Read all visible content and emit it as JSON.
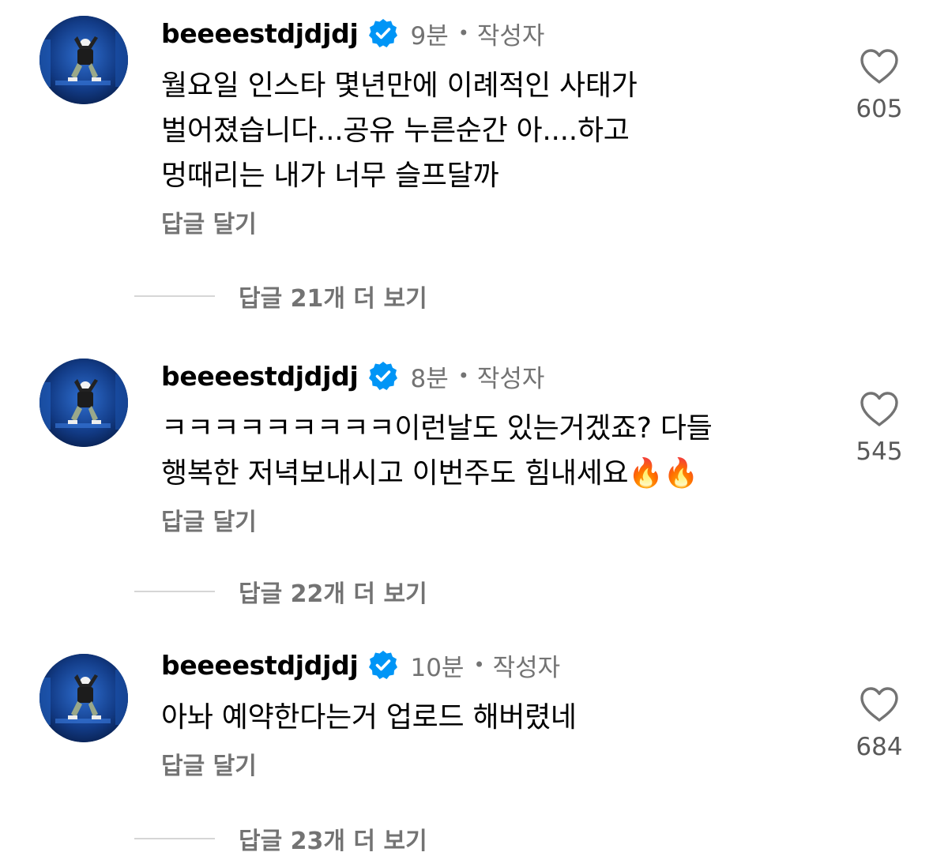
{
  "colors": {
    "secondary_text": "#737373",
    "verified_badge": "#0095f6",
    "divider": "#d6d6d6"
  },
  "icons": {
    "verified": "verified-badge-icon",
    "like": "heart-outline-icon"
  },
  "comments": [
    {
      "username": "beeeestdjdjdj",
      "time": "9분",
      "separator": "•",
      "author_label": "작성자",
      "lines": [
        "월요일 인스타 몇년만에 이례적인 사태가",
        "벌어졌습니다...공유 누른순간 아....하고",
        "멍때리는 내가 너무 슬프달까"
      ],
      "reply_label": "답글 달기",
      "like_count": "605",
      "view_replies_label": "답글 21개 더 보기"
    },
    {
      "username": "beeeestdjdjdj",
      "time": "8분",
      "separator": "•",
      "author_label": "작성자",
      "lines": [
        "ㅋㅋㅋㅋㅋㅋㅋㅋㅋ이런날도 있는거겠죠? 다들",
        "행복한 저녁보내시고 이번주도 힘내세요🔥🔥"
      ],
      "reply_label": "답글 달기",
      "like_count": "545",
      "view_replies_label": "답글 22개 더 보기"
    },
    {
      "username": "beeeestdjdjdj",
      "time": "10분",
      "separator": "•",
      "author_label": "작성자",
      "lines": [
        "아놔 예약한다는거 업로드 해버렸네"
      ],
      "reply_label": "답글 달기",
      "like_count": "684",
      "view_replies_label": "답글 23개 더 보기"
    }
  ]
}
